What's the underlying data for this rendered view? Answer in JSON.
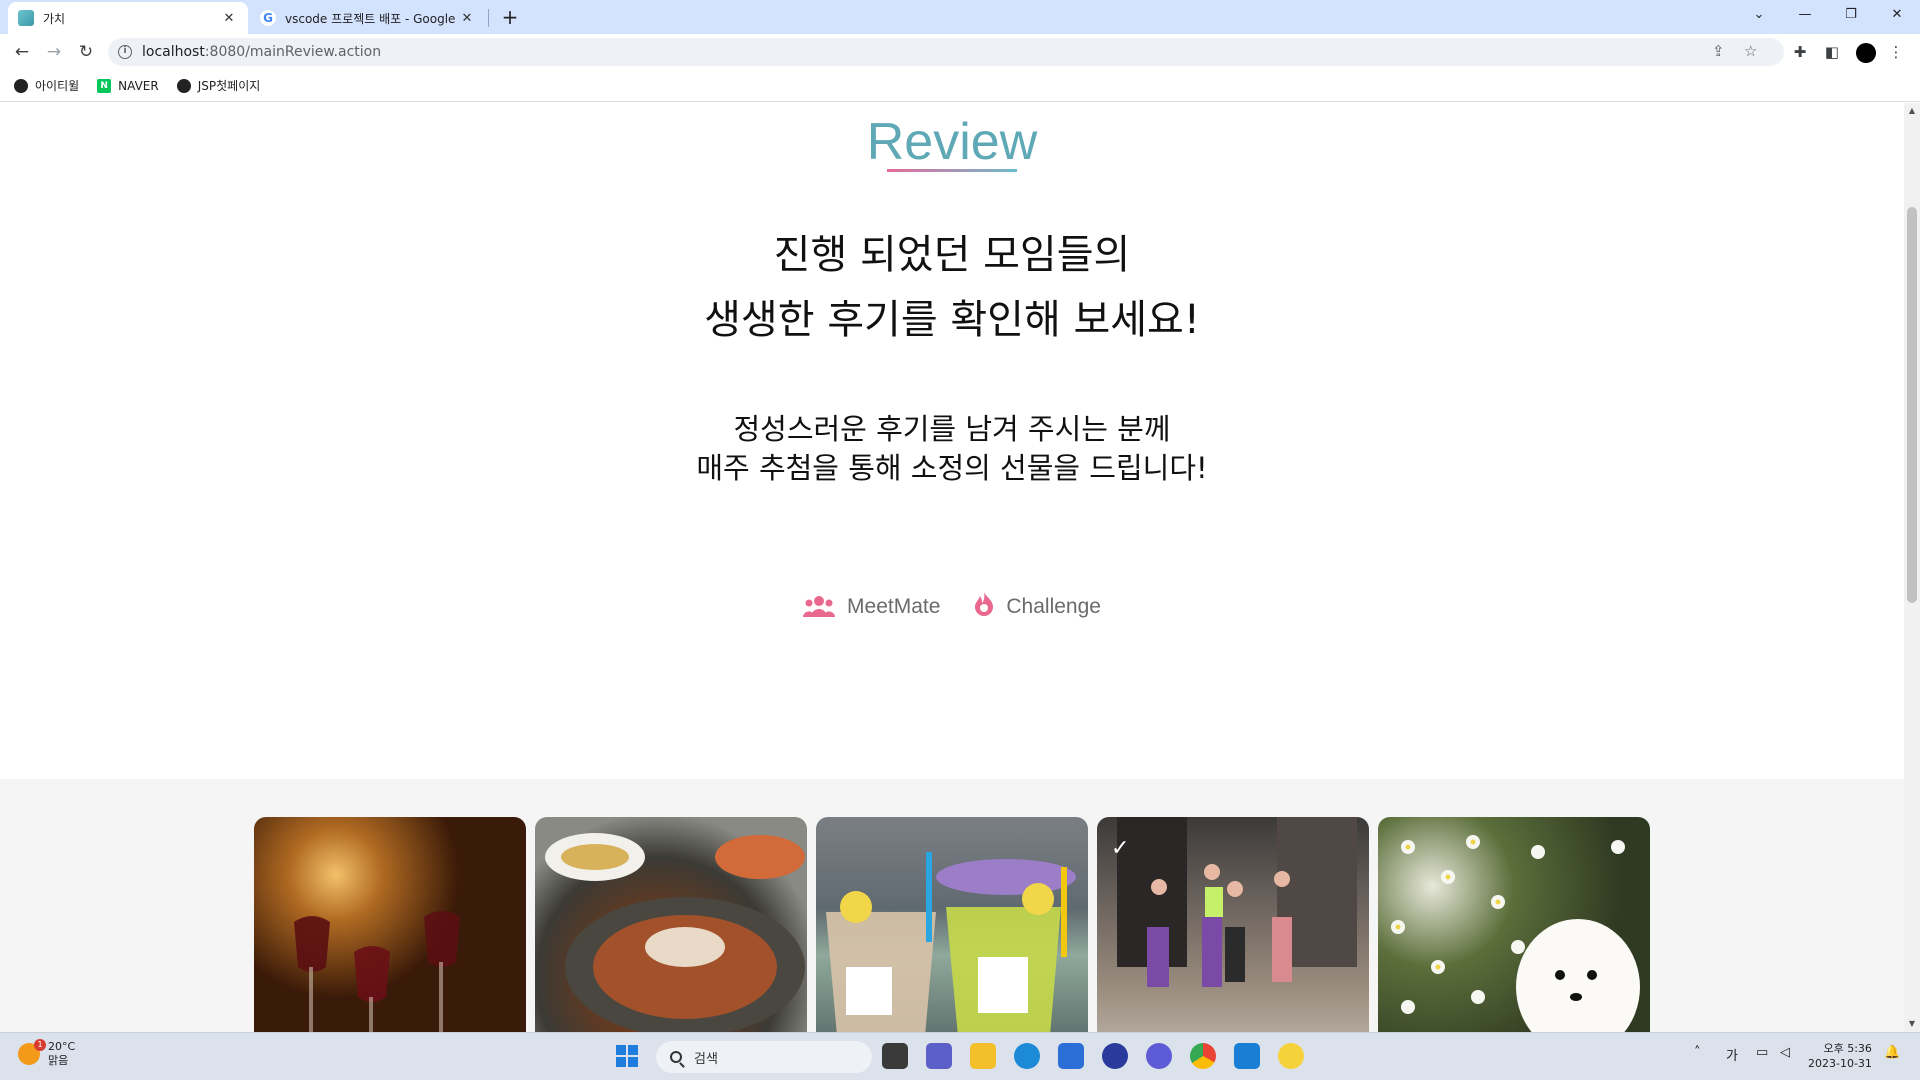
{
  "browser": {
    "tabs": [
      {
        "title": "가치",
        "active": true
      },
      {
        "title": "vscode 프로젝트 배포 - Google",
        "active": false
      }
    ],
    "address": {
      "host": "localhost",
      "path": ":8080/mainReview.action"
    },
    "bookmarks": [
      {
        "label": "아이티윌",
        "icon": "globe-icon"
      },
      {
        "label": "NAVER",
        "icon": "naver-icon"
      },
      {
        "label": "JSP첫페이지",
        "icon": "globe-icon"
      }
    ],
    "glyphs": {
      "close": "✕",
      "new_tab": "+",
      "back": "←",
      "forward": "→",
      "reload": "↻",
      "minimize": "—",
      "restore": "❐",
      "chevron": "⌄",
      "naver": "N"
    }
  },
  "page": {
    "title": "Review",
    "headline_line1": "진행 되었던 모임들의",
    "headline_line2": "생생한 후기를 확인해 보세요!",
    "subline_line1": "정성스러운 후기를 남겨 주시는 분께",
    "subline_line2": "매주 추첨을 통해 소정의 선물을 드립니다!",
    "filters": [
      {
        "label": "MeetMate",
        "icon": "users-icon"
      },
      {
        "label": "Challenge",
        "icon": "flame-icon"
      }
    ],
    "gallery": [
      {
        "subject": "wine-glasses"
      },
      {
        "subject": "korean-food"
      },
      {
        "subject": "iced-drinks"
      },
      {
        "subject": "runners"
      },
      {
        "subject": "white-puppy"
      }
    ],
    "accent_colors": {
      "title": "#5fa9b6",
      "pink": "#e9688f"
    }
  },
  "taskbar": {
    "weather": {
      "temp": "20°C",
      "desc": "맑음",
      "badge": "1"
    },
    "search_placeholder": "검색",
    "ime": "가",
    "time": "오후 5:36",
    "date": "2023-10-31"
  }
}
